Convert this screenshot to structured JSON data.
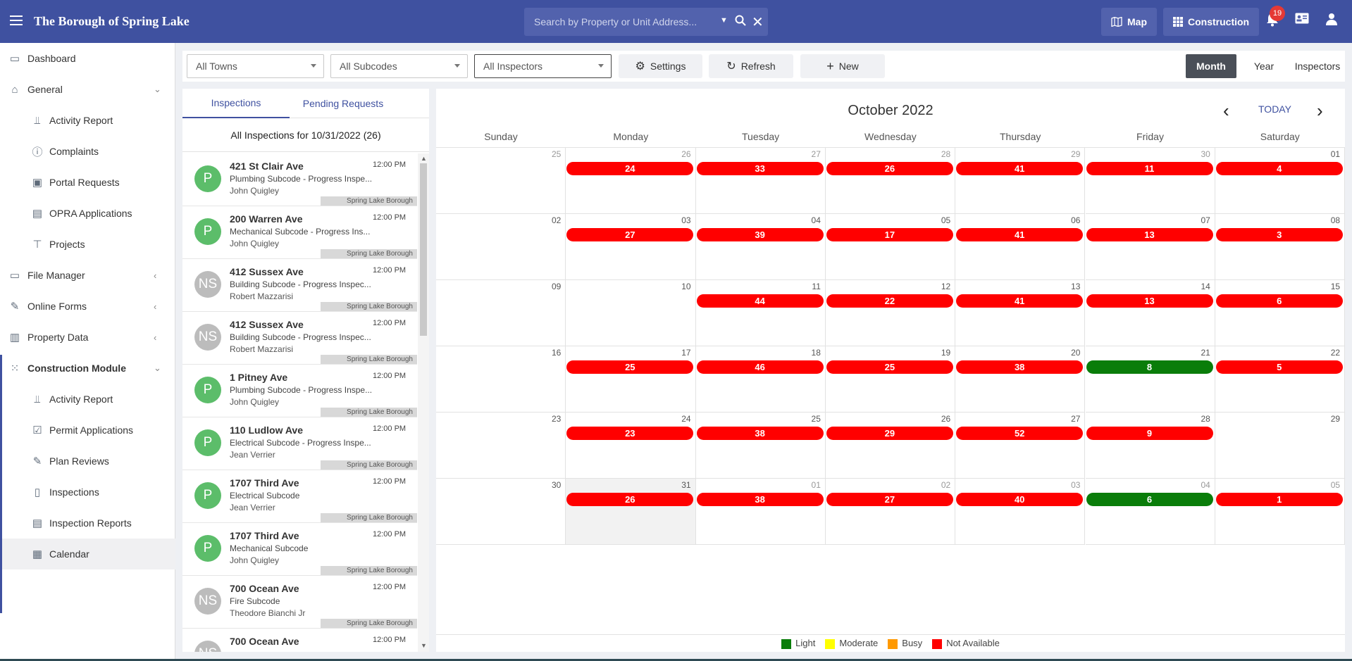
{
  "header": {
    "title": "The Borough of Spring Lake",
    "search_placeholder": "Search by Property or Unit Address...",
    "map_label": "Map",
    "construction_label": "Construction",
    "notification_count": "19"
  },
  "sidebar": {
    "items": [
      {
        "label": "Dashboard",
        "icon": "dashboard-icon"
      },
      {
        "label": "General",
        "icon": "bank-icon"
      },
      {
        "label": "Activity Report",
        "icon": "chart-icon"
      },
      {
        "label": "Complaints",
        "icon": "alert-icon"
      },
      {
        "label": "Portal Requests",
        "icon": "portal-icon"
      },
      {
        "label": "OPRA Applications",
        "icon": "folder-upload-icon"
      },
      {
        "label": "Projects",
        "icon": "crane-icon"
      },
      {
        "label": "File Manager",
        "icon": "monitor-icon"
      },
      {
        "label": "Online Forms",
        "icon": "form-edit-icon"
      },
      {
        "label": "Property Data",
        "icon": "buildings-icon"
      },
      {
        "label": "Construction Module",
        "icon": "grid-icon"
      },
      {
        "label": "Activity Report",
        "icon": "chart-icon"
      },
      {
        "label": "Permit Applications",
        "icon": "checkbox-icon"
      },
      {
        "label": "Plan Reviews",
        "icon": "pencil-icon"
      },
      {
        "label": "Inspections",
        "icon": "phone-icon"
      },
      {
        "label": "Inspection Reports",
        "icon": "document-icon"
      },
      {
        "label": "Calendar",
        "icon": "calendar-icon"
      }
    ]
  },
  "toolbar": {
    "towns": "All Towns",
    "subcodes": "All Subcodes",
    "inspectors": "All Inspectors",
    "settings": "Settings",
    "refresh": "Refresh",
    "new": "New",
    "views": [
      "Month",
      "Year",
      "Inspectors"
    ],
    "active_view": "Month"
  },
  "list": {
    "tabs": [
      "Inspections",
      "Pending Requests"
    ],
    "heading": "All Inspections for 10/31/2022 (26)",
    "rows": [
      {
        "avatar": "P",
        "address": "421 St Clair Ave",
        "time": "12:00 PM",
        "type": "Plumbing Subcode - Progress Inspe...",
        "inspector": "John Quigley",
        "town": "Spring Lake Borough"
      },
      {
        "avatar": "P",
        "address": "200 Warren Ave",
        "time": "12:00 PM",
        "type": "Mechanical Subcode - Progress Ins...",
        "inspector": "John Quigley",
        "town": "Spring Lake Borough"
      },
      {
        "avatar": "NS",
        "address": "412 Sussex Ave",
        "time": "12:00 PM",
        "type": "Building Subcode - Progress Inspec...",
        "inspector": "Robert Mazzarisi",
        "town": "Spring Lake Borough"
      },
      {
        "avatar": "NS",
        "address": "412 Sussex Ave",
        "time": "12:00 PM",
        "type": "Building Subcode - Progress Inspec...",
        "inspector": "Robert Mazzarisi",
        "town": "Spring Lake Borough"
      },
      {
        "avatar": "P",
        "address": "1 Pitney Ave",
        "time": "12:00 PM",
        "type": "Plumbing Subcode - Progress Inspe...",
        "inspector": "John Quigley",
        "town": "Spring Lake Borough"
      },
      {
        "avatar": "P",
        "address": "110 Ludlow Ave",
        "time": "12:00 PM",
        "type": "Electrical Subcode - Progress Inspe...",
        "inspector": "Jean Verrier",
        "town": "Spring Lake Borough"
      },
      {
        "avatar": "P",
        "address": "1707 Third Ave",
        "time": "12:00 PM",
        "type": "Electrical Subcode",
        "inspector": "Jean Verrier",
        "town": "Spring Lake Borough"
      },
      {
        "avatar": "P",
        "address": "1707 Third Ave",
        "time": "12:00 PM",
        "type": "Mechanical Subcode",
        "inspector": "John Quigley",
        "town": "Spring Lake Borough"
      },
      {
        "avatar": "NS",
        "address": "700 Ocean Ave",
        "time": "12:00 PM",
        "type": "Fire Subcode",
        "inspector": "Theodore Bianchi Jr",
        "town": "Spring Lake Borough"
      },
      {
        "avatar": "NS",
        "address": "700 Ocean Ave",
        "time": "12:00 PM",
        "type": "",
        "inspector": "",
        "town": ""
      }
    ]
  },
  "calendar": {
    "title": "October 2022",
    "today_label": "TODAY",
    "days": [
      "Sunday",
      "Monday",
      "Tuesday",
      "Wednesday",
      "Thursday",
      "Friday",
      "Saturday"
    ],
    "weeks": [
      [
        {
          "d": "25",
          "o": true,
          "c": ""
        },
        {
          "d": "26",
          "o": true,
          "c": "24",
          "s": "na"
        },
        {
          "d": "27",
          "o": true,
          "c": "33",
          "s": "na"
        },
        {
          "d": "28",
          "o": true,
          "c": "26",
          "s": "na"
        },
        {
          "d": "29",
          "o": true,
          "c": "41",
          "s": "na"
        },
        {
          "d": "30",
          "o": true,
          "c": "11",
          "s": "na"
        },
        {
          "d": "01",
          "o": false,
          "c": "4",
          "s": "na"
        }
      ],
      [
        {
          "d": "02",
          "o": false,
          "c": ""
        },
        {
          "d": "03",
          "o": false,
          "c": "27",
          "s": "na"
        },
        {
          "d": "04",
          "o": false,
          "c": "39",
          "s": "na"
        },
        {
          "d": "05",
          "o": false,
          "c": "17",
          "s": "na"
        },
        {
          "d": "06",
          "o": false,
          "c": "41",
          "s": "na"
        },
        {
          "d": "07",
          "o": false,
          "c": "13",
          "s": "na"
        },
        {
          "d": "08",
          "o": false,
          "c": "3",
          "s": "na"
        }
      ],
      [
        {
          "d": "09",
          "o": false,
          "c": ""
        },
        {
          "d": "10",
          "o": false,
          "c": ""
        },
        {
          "d": "11",
          "o": false,
          "c": "44",
          "s": "na"
        },
        {
          "d": "12",
          "o": false,
          "c": "22",
          "s": "na"
        },
        {
          "d": "13",
          "o": false,
          "c": "41",
          "s": "na"
        },
        {
          "d": "14",
          "o": false,
          "c": "13",
          "s": "na"
        },
        {
          "d": "15",
          "o": false,
          "c": "6",
          "s": "na"
        }
      ],
      [
        {
          "d": "16",
          "o": false,
          "c": ""
        },
        {
          "d": "17",
          "o": false,
          "c": "25",
          "s": "na"
        },
        {
          "d": "18",
          "o": false,
          "c": "46",
          "s": "na"
        },
        {
          "d": "19",
          "o": false,
          "c": "25",
          "s": "na"
        },
        {
          "d": "20",
          "o": false,
          "c": "38",
          "s": "na"
        },
        {
          "d": "21",
          "o": false,
          "c": "8",
          "s": "light"
        },
        {
          "d": "22",
          "o": false,
          "c": "5",
          "s": "na"
        }
      ],
      [
        {
          "d": "23",
          "o": false,
          "c": ""
        },
        {
          "d": "24",
          "o": false,
          "c": "23",
          "s": "na"
        },
        {
          "d": "25",
          "o": false,
          "c": "38",
          "s": "na"
        },
        {
          "d": "26",
          "o": false,
          "c": "29",
          "s": "na"
        },
        {
          "d": "27",
          "o": false,
          "c": "52",
          "s": "na"
        },
        {
          "d": "28",
          "o": false,
          "c": "9",
          "s": "na"
        },
        {
          "d": "29",
          "o": false,
          "c": ""
        }
      ],
      [
        {
          "d": "30",
          "o": false,
          "c": ""
        },
        {
          "d": "31",
          "o": false,
          "c": "26",
          "s": "na",
          "today": true
        },
        {
          "d": "01",
          "o": true,
          "c": "38",
          "s": "na"
        },
        {
          "d": "02",
          "o": true,
          "c": "27",
          "s": "na"
        },
        {
          "d": "03",
          "o": true,
          "c": "40",
          "s": "na"
        },
        {
          "d": "04",
          "o": true,
          "c": "6",
          "s": "light"
        },
        {
          "d": "05",
          "o": true,
          "c": "1",
          "s": "na"
        }
      ]
    ],
    "legend": [
      {
        "label": "Light",
        "color": "#0a7d0a"
      },
      {
        "label": "Moderate",
        "color": "#ffff00"
      },
      {
        "label": "Busy",
        "color": "#ff9900"
      },
      {
        "label": "Not Available",
        "color": "#ff0000"
      }
    ],
    "status_colors": {
      "na": "#ff0000",
      "light": "#0a7d0a"
    }
  }
}
